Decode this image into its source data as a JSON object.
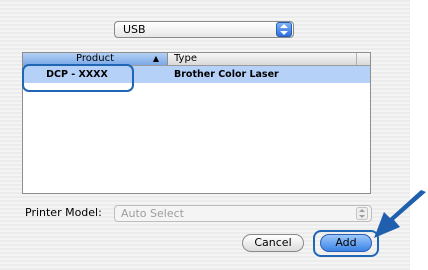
{
  "connection": {
    "selected": "USB"
  },
  "table": {
    "columns": {
      "product": "Product",
      "type": "Type"
    },
    "rows": [
      {
        "product": "DCP - XXXX",
        "type": "Brother Color Laser"
      }
    ]
  },
  "printer_model": {
    "label": "Printer Model:",
    "selected": "Auto Select"
  },
  "buttons": {
    "cancel": "Cancel",
    "add": "Add"
  },
  "colors": {
    "accent": "#1f67b4",
    "selection": "#b5d1f7"
  }
}
